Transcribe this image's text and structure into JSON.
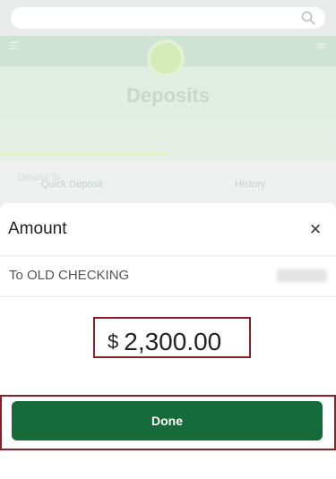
{
  "background": {
    "page_title": "Deposits",
    "tabs": [
      "Quick Deposit",
      "History"
    ],
    "deposit_to_label": "Deposit To"
  },
  "sheet": {
    "title": "Amount",
    "close_glyph": "×",
    "to_account": "To OLD CHECKING",
    "currency_symbol": "$",
    "amount": "2,300.00",
    "done_label": "Done"
  },
  "colors": {
    "brand_green": "#156b3a",
    "highlight_red": "#8b1e27"
  }
}
